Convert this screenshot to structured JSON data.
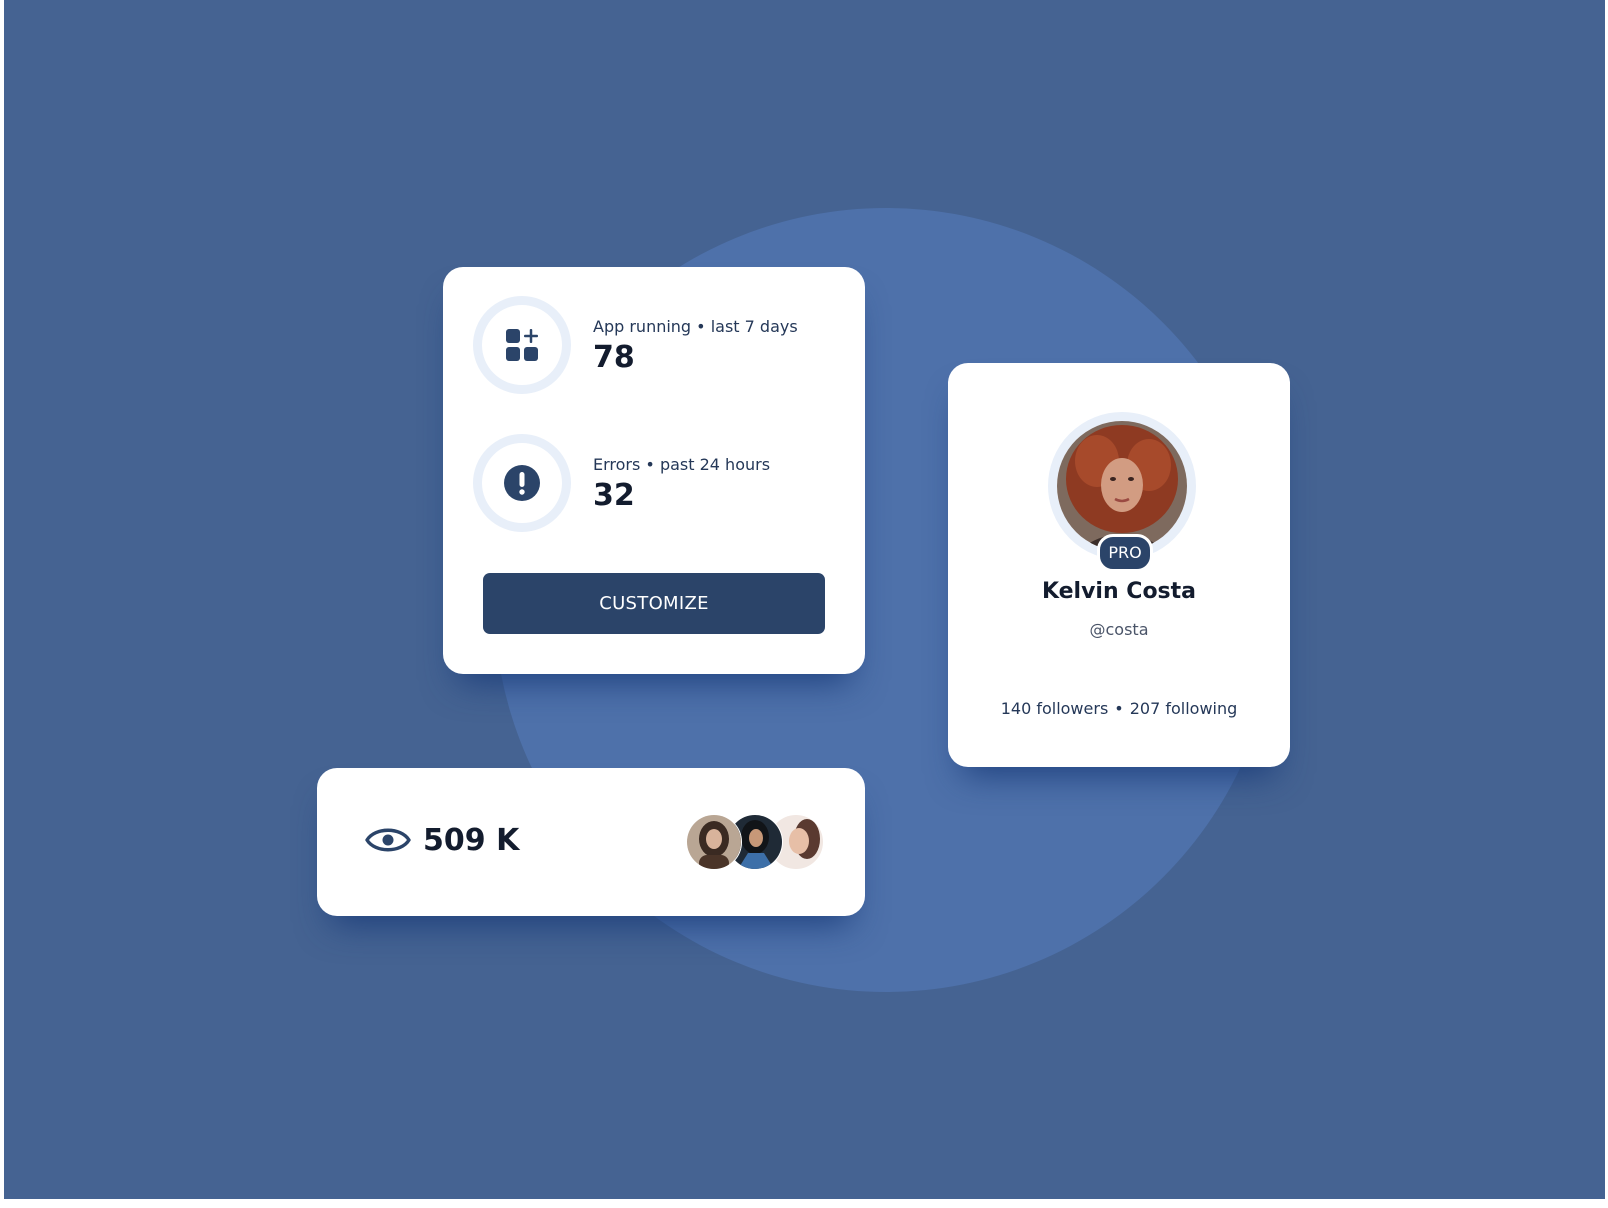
{
  "colors": {
    "background": "#456392",
    "circle": "#4e71aa",
    "card": "#ffffff",
    "primary": "#2b4469",
    "ring": "#e8eff9"
  },
  "stats_card": {
    "items": [
      {
        "icon": "apps-add-icon",
        "label": "App running • last 7 days",
        "value": "78"
      },
      {
        "icon": "alert-icon",
        "label": "Errors • past 24 hours",
        "value": "32"
      }
    ],
    "button_label": "CUSTOMIZE"
  },
  "views_card": {
    "icon": "eye-icon",
    "value": "509 K",
    "avatar_count": 3
  },
  "profile_card": {
    "badge": "PRO",
    "name": "Kelvin Costa",
    "handle": "@costa",
    "followers": "140 followers",
    "separator": "•",
    "following": "207 following"
  }
}
